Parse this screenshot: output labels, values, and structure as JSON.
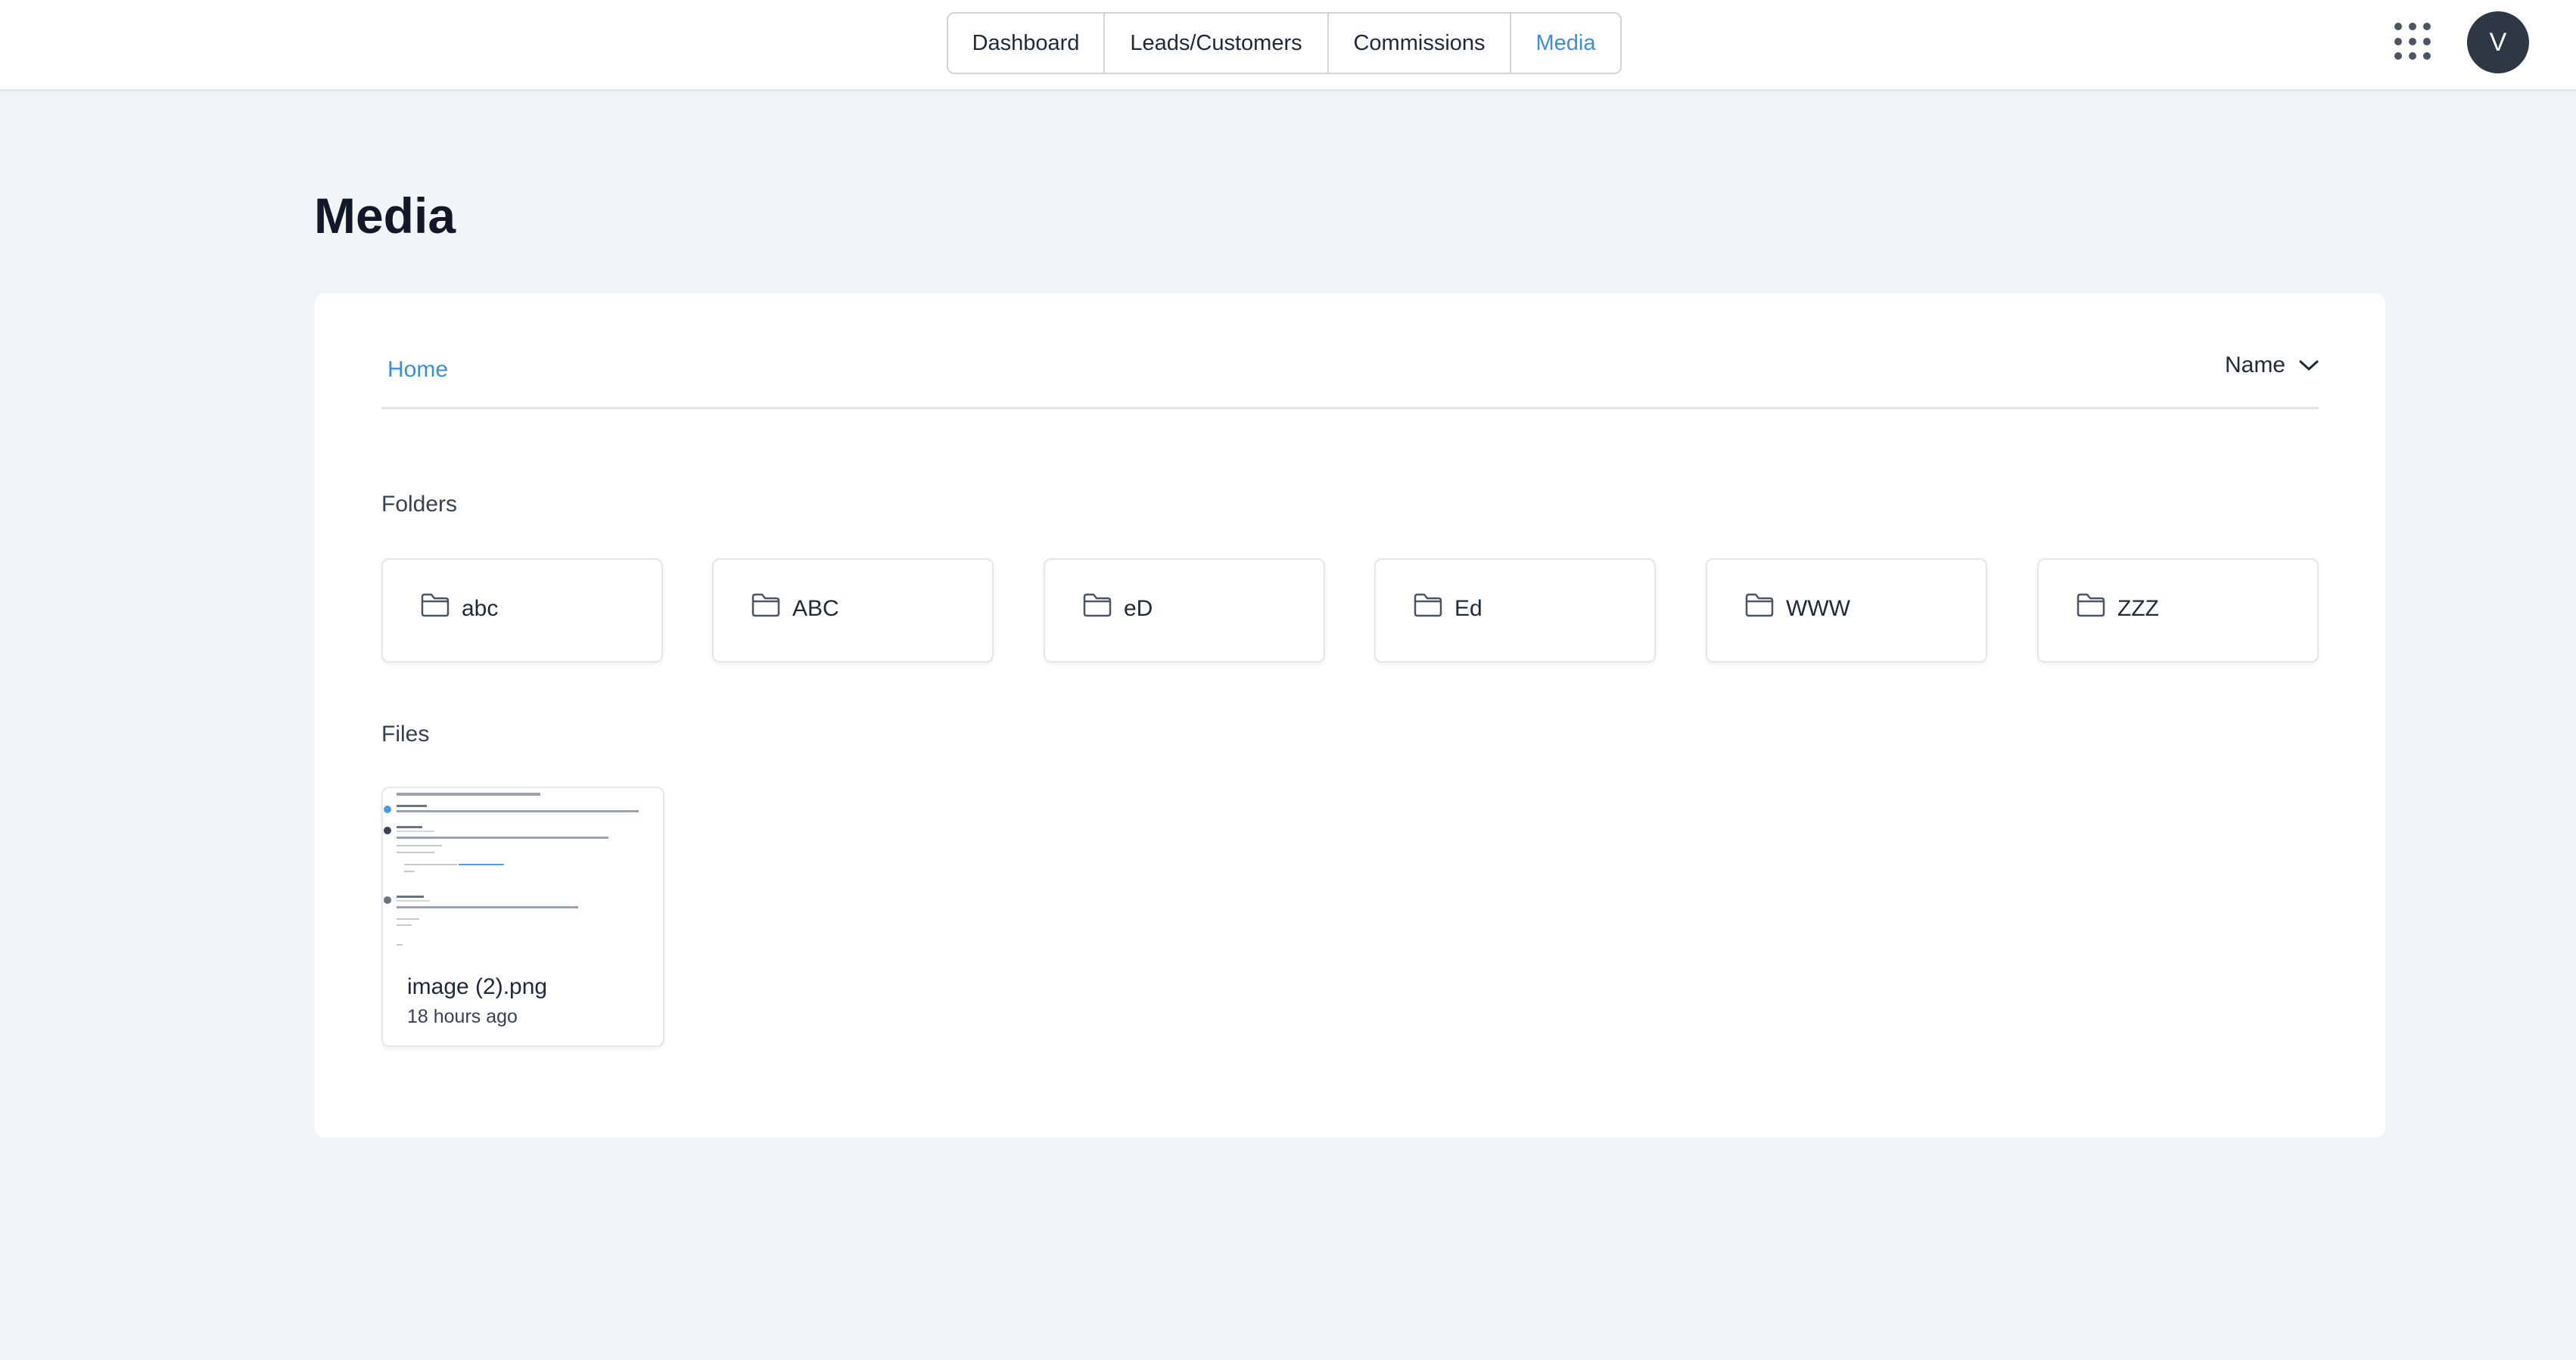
{
  "nav": {
    "tabs": [
      {
        "label": "Dashboard"
      },
      {
        "label": "Leads/Customers"
      },
      {
        "label": "Commissions"
      },
      {
        "label": "Media"
      }
    ],
    "active_tab": "Media",
    "apps_icon": "grid-apps-icon",
    "avatar_initial": "V"
  },
  "page": {
    "title": "Media"
  },
  "breadcrumb": {
    "home": "Home"
  },
  "sort": {
    "selected": "Name",
    "icon": "chevron-down-icon"
  },
  "folders_section": {
    "label": "Folders",
    "items": [
      {
        "name": "abc",
        "icon": "folder-icon"
      },
      {
        "name": "ABC",
        "icon": "folder-icon"
      },
      {
        "name": "eD",
        "icon": "folder-icon"
      },
      {
        "name": "Ed",
        "icon": "folder-icon"
      },
      {
        "name": "WWW",
        "icon": "folder-icon"
      },
      {
        "name": "ZZZ",
        "icon": "folder-icon"
      }
    ]
  },
  "files_section": {
    "label": "Files",
    "items": [
      {
        "name": "image (2).png",
        "modified": "18 hours ago"
      }
    ]
  },
  "colors": {
    "accent": "#3a8fd9",
    "avatar_bg": "#2d3844",
    "page_bg": "#f1f5f8"
  }
}
